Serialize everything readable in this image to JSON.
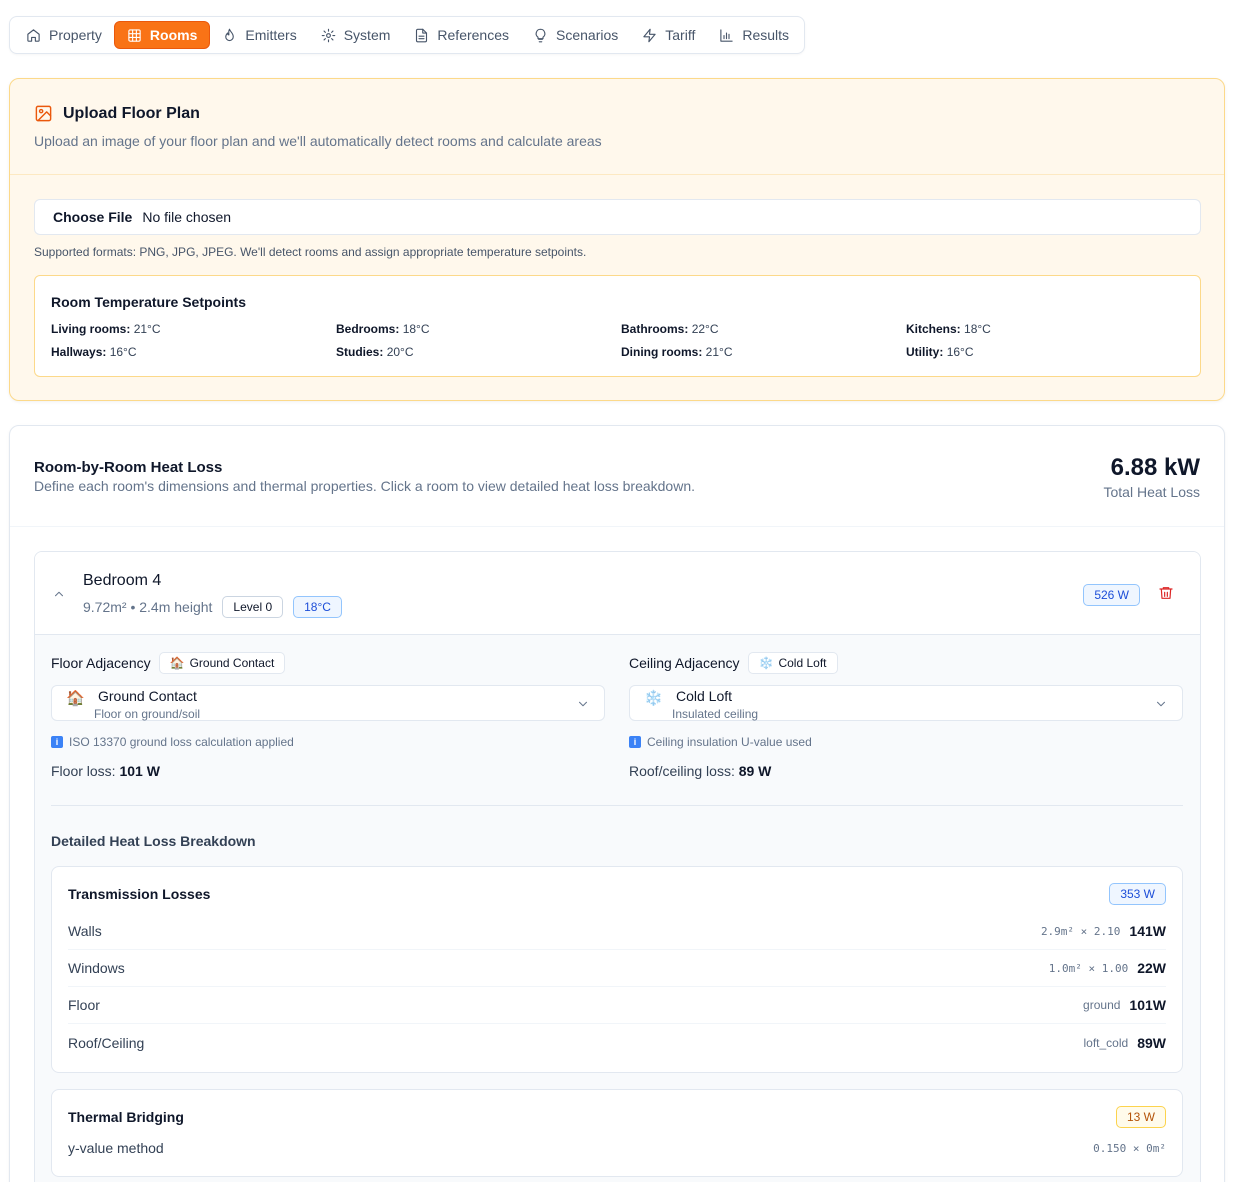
{
  "tabs": [
    {
      "label": "Property",
      "icon": "home-icon"
    },
    {
      "label": "Rooms",
      "icon": "grid-icon",
      "active": true
    },
    {
      "label": "Emitters",
      "icon": "flame-icon"
    },
    {
      "label": "System",
      "icon": "gear-icon"
    },
    {
      "label": "References",
      "icon": "document-icon"
    },
    {
      "label": "Scenarios",
      "icon": "lightbulb-icon"
    },
    {
      "label": "Tariff",
      "icon": "lightning-icon"
    },
    {
      "label": "Results",
      "icon": "bar-chart-icon"
    }
  ],
  "upload": {
    "title": "Upload Floor Plan",
    "subtitle": "Upload an image of your floor plan and we'll automatically detect rooms and calculate areas",
    "choose_label": "Choose File",
    "file_status": "No file chosen",
    "formats_note": "Supported formats: PNG, JPG, JPEG. We'll detect rooms and assign appropriate temperature setpoints.",
    "setpoints_title": "Room Temperature Setpoints",
    "setpoints": [
      {
        "label": "Living rooms:",
        "value": "21°C"
      },
      {
        "label": "Bedrooms:",
        "value": "18°C"
      },
      {
        "label": "Bathrooms:",
        "value": "22°C"
      },
      {
        "label": "Kitchens:",
        "value": "18°C"
      },
      {
        "label": "Hallways:",
        "value": "16°C"
      },
      {
        "label": "Studies:",
        "value": "20°C"
      },
      {
        "label": "Dining rooms:",
        "value": "21°C"
      },
      {
        "label": "Utility:",
        "value": "16°C"
      }
    ]
  },
  "heat_loss": {
    "title": "Room-by-Room Heat Loss",
    "subtitle": "Define each room's dimensions and thermal properties. Click a room to view detailed heat loss breakdown.",
    "total_value": "6.88 kW",
    "total_label": "Total Heat Loss"
  },
  "room": {
    "name": "Bedroom 4",
    "meta": "9.72m² • 2.4m height",
    "level": "Level 0",
    "temp": "18°C",
    "watts": "526 W",
    "floor": {
      "label": "Floor Adjacency",
      "badge_emoji": "🏠",
      "badge": "Ground Contact",
      "select_emoji": "🏠",
      "select_title": "Ground Contact",
      "select_sub": "Floor on ground/soil",
      "info": "ISO 13370 ground loss calculation applied",
      "loss_label": "Floor loss:",
      "loss_value": "101 W"
    },
    "ceiling": {
      "label": "Ceiling Adjacency",
      "badge_emoji": "❄️",
      "badge": "Cold Loft",
      "select_emoji": "❄️",
      "select_title": "Cold Loft",
      "select_sub": "Insulated ceiling",
      "info": "Ceiling insulation U-value used",
      "loss_label": "Roof/ceiling loss:",
      "loss_value": "89 W"
    },
    "breakdown_title": "Detailed Heat Loss Breakdown",
    "transmission": {
      "title": "Transmission Losses",
      "badge": "353 W",
      "rows": [
        {
          "label": "Walls",
          "calc": "2.9m² × 2.10",
          "value": "141W"
        },
        {
          "label": "Windows",
          "calc": "1.0m² × 1.00",
          "value": "22W"
        },
        {
          "label": "Floor",
          "calc": "ground",
          "value": "101W"
        },
        {
          "label": "Roof/Ceiling",
          "calc": "loft_cold",
          "value": "89W"
        }
      ]
    },
    "bridging": {
      "title": "Thermal Bridging",
      "badge": "13 W",
      "method": "y-value method",
      "calc": "0.150 × 0m²"
    }
  },
  "colors": {
    "accent": "#f97316",
    "upload_bg": "#fff8ec",
    "info_blue": "#1d4ed8",
    "danger": "#dc2626"
  }
}
